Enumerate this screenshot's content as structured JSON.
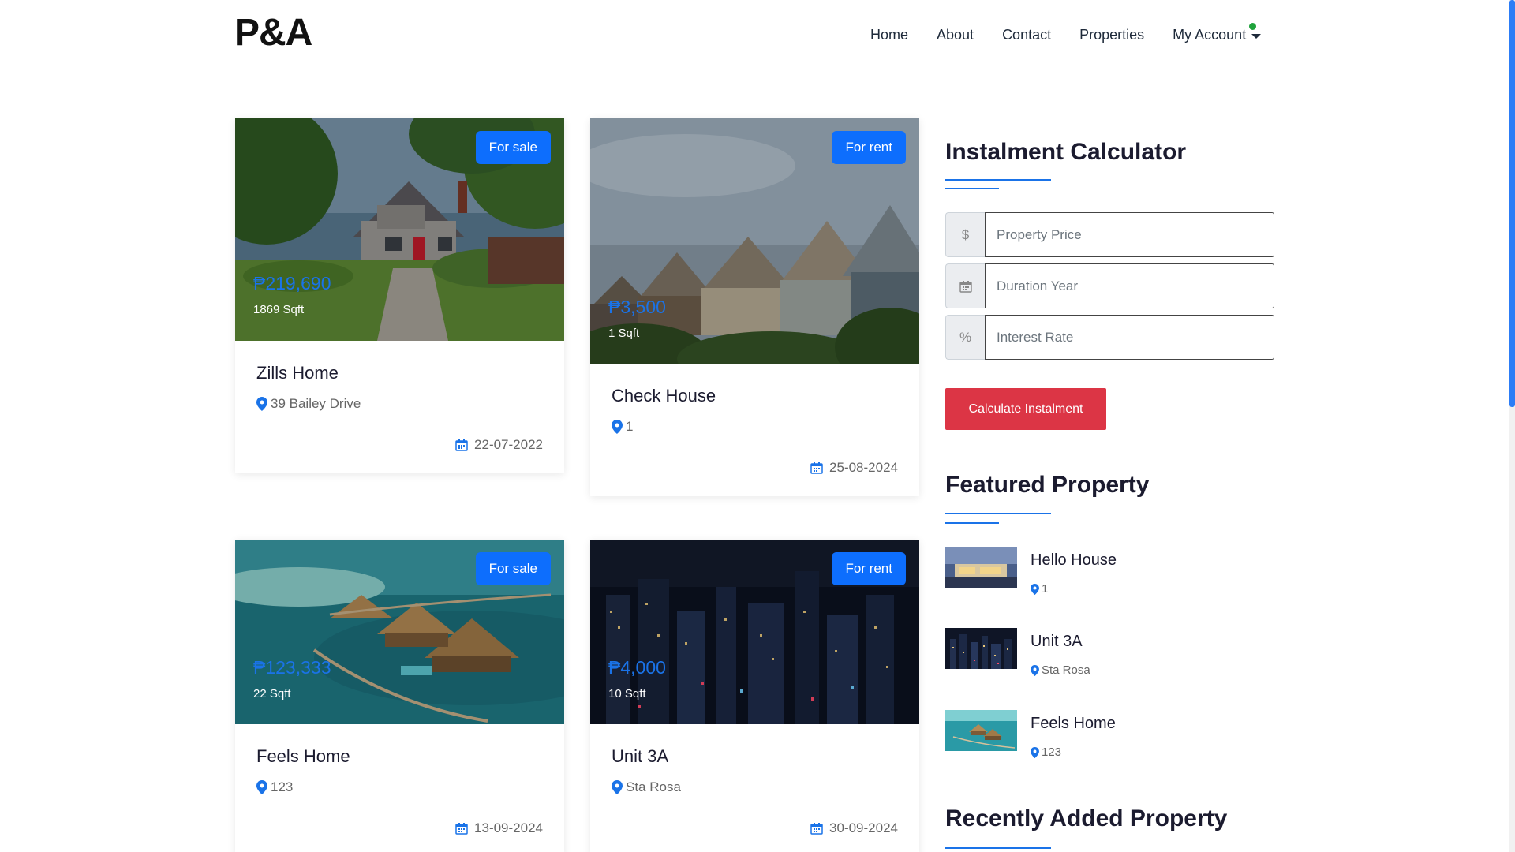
{
  "brand": {
    "logo": "P&A"
  },
  "nav": {
    "items": [
      "Home",
      "About",
      "Contact",
      "Properties"
    ],
    "account_label": "My Account"
  },
  "listings": [
    {
      "badge": "For sale",
      "price": "₱219,690",
      "sqft": "1869 Sqft",
      "title": "Zills Home",
      "location": "39 Bailey Drive",
      "date": "22-07-2022"
    },
    {
      "badge": "For rent",
      "price": "₱3,500",
      "sqft": "1 Sqft",
      "title": "Check House",
      "location": "1",
      "date": "25-08-2024"
    },
    {
      "badge": "For sale",
      "price": "₱123,333",
      "sqft": "22 Sqft",
      "title": "Feels Home",
      "location": "123",
      "date": "13-09-2024"
    },
    {
      "badge": "For rent",
      "price": "₱4,000",
      "sqft": "10 Sqft",
      "title": "Unit 3A",
      "location": "Sta Rosa",
      "date": "30-09-2024"
    }
  ],
  "calculator": {
    "heading": "Instalment Calculator",
    "fields": [
      {
        "addon": "$",
        "placeholder": "Property Price",
        "value": ""
      },
      {
        "addon": "calendar-icon",
        "placeholder": "Duration Year",
        "value": ""
      },
      {
        "addon": "%",
        "placeholder": "Interest Rate",
        "value": ""
      }
    ],
    "button": "Calculate Instalment"
  },
  "featured": {
    "heading": "Featured Property",
    "items": [
      {
        "title": "Hello House",
        "location": "1"
      },
      {
        "title": "Unit 3A",
        "location": "Sta Rosa"
      },
      {
        "title": "Feels Home",
        "location": "123"
      }
    ]
  },
  "recent": {
    "heading": "Recently Added Property"
  },
  "colors": {
    "accent": "#0d6efd",
    "price": "#1a73e8",
    "danger": "#dc3545",
    "online": "#1fa33c"
  }
}
